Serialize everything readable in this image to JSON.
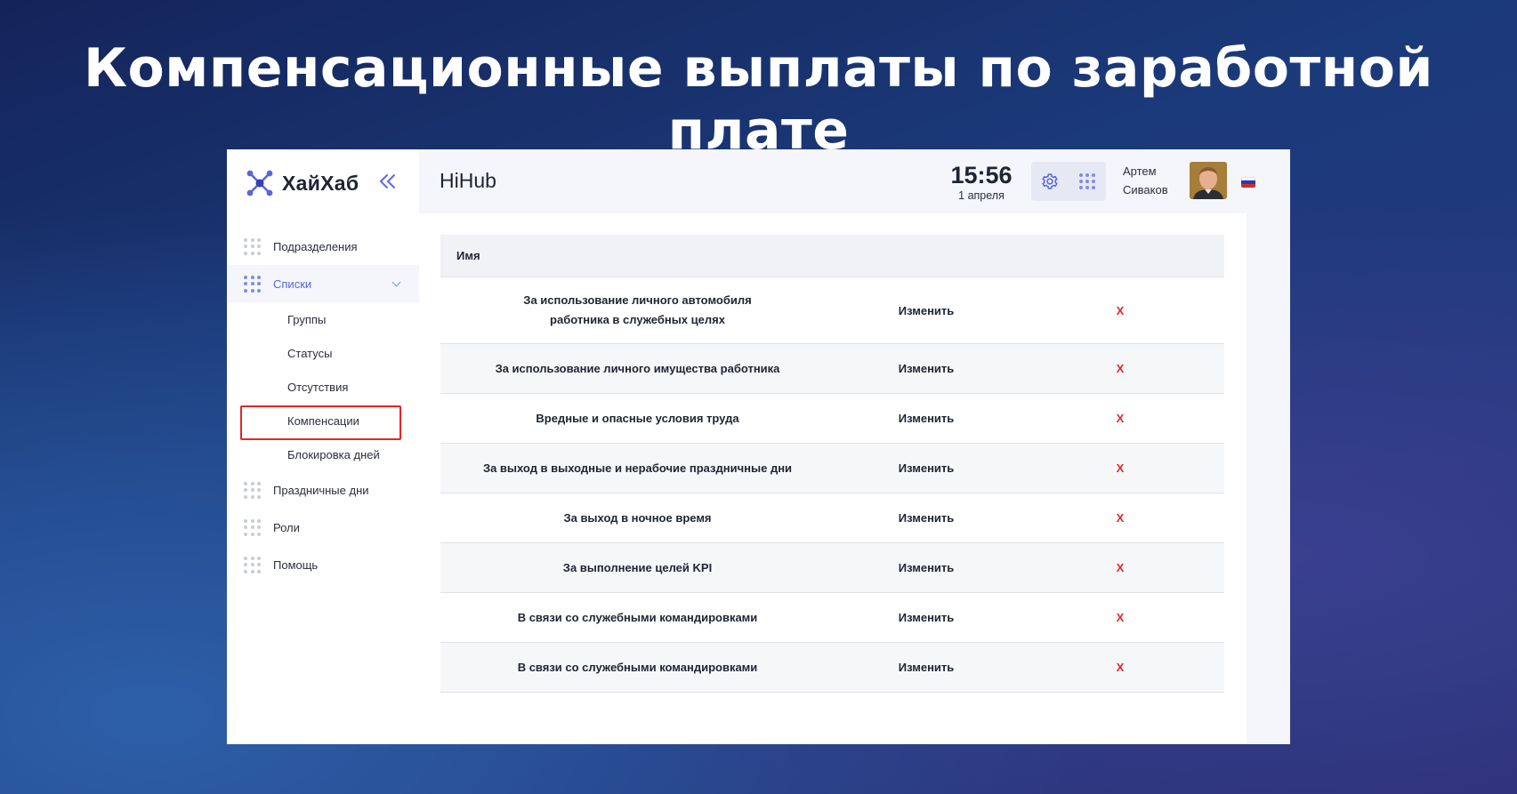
{
  "slide": {
    "title": "Компенсационные выплаты по заработной плате"
  },
  "logo": {
    "text": "ХайХаб"
  },
  "sidebar": {
    "collapse_icon": "double-chevron-left-icon",
    "items": [
      {
        "label": "Подразделения"
      },
      {
        "label": "Списки",
        "active": true
      },
      {
        "label": "Праздничные дни"
      },
      {
        "label": "Роли"
      },
      {
        "label": "Помощь"
      }
    ],
    "subitems": [
      {
        "label": "Группы"
      },
      {
        "label": "Статусы"
      },
      {
        "label": "Отсутствия"
      },
      {
        "label": "Компенсации",
        "highlighted": true
      },
      {
        "label": "Блокировка дней"
      }
    ]
  },
  "header": {
    "title": "HiHub",
    "time": "15:56",
    "date": "1 апреля",
    "user_first": "Артем",
    "user_last": "Сиваков"
  },
  "table": {
    "header": "Имя",
    "edit_label": "Изменить",
    "delete_label": "X",
    "rows": [
      {
        "name": "За использование личного автомобиля работника в служебных целях"
      },
      {
        "name": "За использование личного имущества работника"
      },
      {
        "name": "Вредные и опасные условия труда"
      },
      {
        "name": "За выход в выходные и нерабочие праздничные дни"
      },
      {
        "name": "За выход в ночное время"
      },
      {
        "name": "За выполнение целей KPI"
      },
      {
        "name": "В связи со служебными командировками"
      },
      {
        "name": "В связи со служебными командировками"
      }
    ]
  },
  "colors": {
    "accent": "#5766d8",
    "delete": "#e32626",
    "highlight_border": "#e32626"
  }
}
